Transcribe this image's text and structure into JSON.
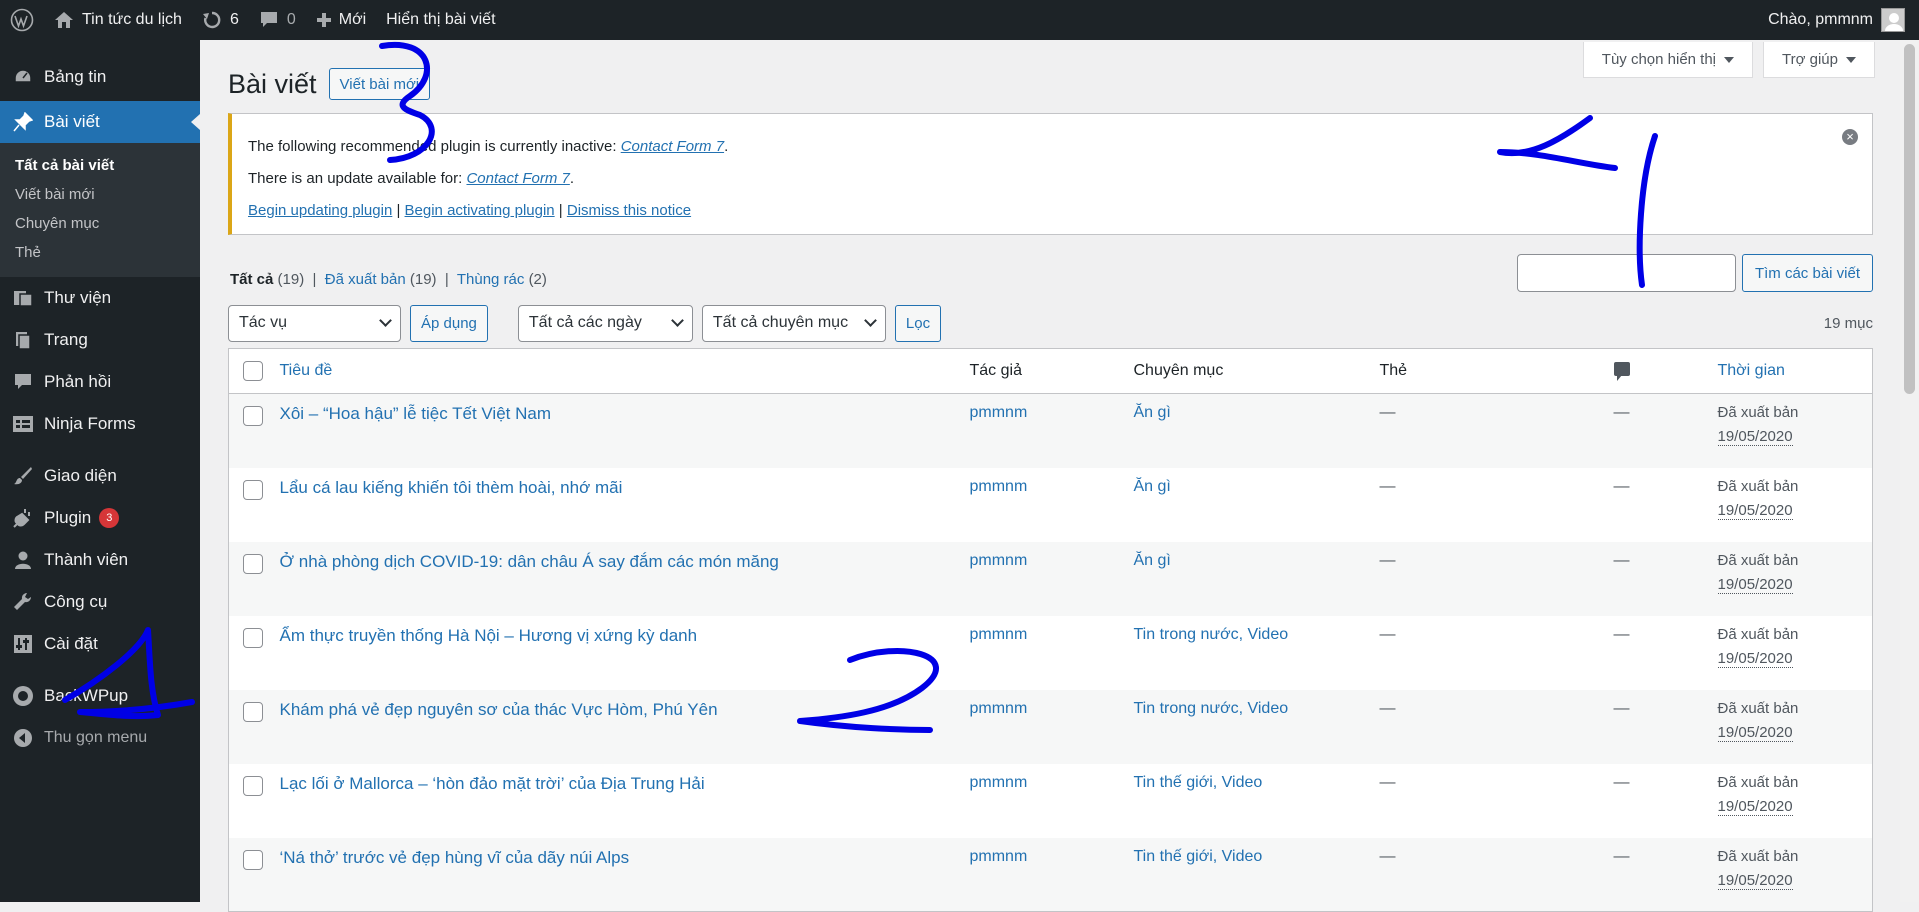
{
  "admin_bar": {
    "site_name": "Tin tức du lịch",
    "updates_count": "6",
    "comments_count": "0",
    "new_label": "Mới",
    "view_label": "Hiển thị bài viết",
    "greeting": "Chào, pmmnm"
  },
  "sidebar": {
    "items": [
      {
        "label": "Bảng tin",
        "icon": "dashboard-icon"
      },
      {
        "label": "Bài viết",
        "icon": "pin-icon"
      },
      {
        "label": "Thư viện",
        "icon": "media-icon"
      },
      {
        "label": "Trang",
        "icon": "page-icon"
      },
      {
        "label": "Phản hồi",
        "icon": "comments-icon"
      },
      {
        "label": "Ninja Forms",
        "icon": "forms-icon"
      },
      {
        "label": "Giao diện",
        "icon": "brush-icon"
      },
      {
        "label": "Plugin",
        "icon": "plugin-icon",
        "badge": "3"
      },
      {
        "label": "Thành viên",
        "icon": "user-icon"
      },
      {
        "label": "Công cụ",
        "icon": "wrench-icon"
      },
      {
        "label": "Cài đặt",
        "icon": "settings-icon"
      },
      {
        "label": "BackWPup",
        "icon": "backwpup-icon"
      },
      {
        "label": "Thu gọn menu",
        "icon": "collapse-icon"
      }
    ],
    "submenu": [
      "Tất cả bài viết",
      "Viết bài mới",
      "Chuyên mục",
      "Thẻ"
    ]
  },
  "screen_meta": {
    "options_label": "Tùy chọn hiển thị",
    "help_label": "Trợ giúp"
  },
  "page": {
    "title": "Bài viết",
    "add_new": "Viết bài mới"
  },
  "notice": {
    "line1_text": "The following recommended plugin is currently inactive: ",
    "line1_link": "Contact Form 7",
    "line2_text": "There is an update available for: ",
    "line2_link": "Contact Form 7",
    "link_update": "Begin updating plugin",
    "link_activate": "Begin activating plugin",
    "link_dismiss": "Dismiss this notice"
  },
  "views": {
    "all": "Tất cả",
    "all_count": "(19)",
    "published": "Đã xuất bản",
    "published_count": "(19)",
    "trash": "Thùng rác",
    "trash_count": "(2)"
  },
  "search": {
    "button": "Tìm các bài viết",
    "value": ""
  },
  "tablenav": {
    "bulk_action": "Tác vụ",
    "apply": "Áp dụng",
    "dates": "Tất cả các ngày",
    "categories": "Tất cả chuyên mục",
    "filter": "Lọc",
    "items_count": "19 mục"
  },
  "table": {
    "columns": {
      "title": "Tiêu đề",
      "author": "Tác giả",
      "categories": "Chuyên mục",
      "tags": "Thẻ",
      "date": "Thời gian"
    },
    "rows": [
      {
        "title": "Xôi – “Hoa hậu” lễ tiệc Tết Việt Nam",
        "author": "pmmnm",
        "categories": "Ăn gì",
        "tags": "—",
        "comments": "—",
        "status": "Đã xuất bản",
        "date": "19/05/2020"
      },
      {
        "title": "Lẩu cá lau kiếng khiến tôi thèm hoài, nhớ mãi",
        "author": "pmmnm",
        "categories": "Ăn gì",
        "tags": "—",
        "comments": "—",
        "status": "Đã xuất bản",
        "date": "19/05/2020"
      },
      {
        "title": "Ở nhà phòng dịch COVID-19: dân châu Á say đắm các món măng",
        "author": "pmmnm",
        "categories": "Ăn gì",
        "tags": "—",
        "comments": "—",
        "status": "Đã xuất bản",
        "date": "19/05/2020"
      },
      {
        "title": "Ẩm thực truyền thống Hà Nội – Hương vị xứng kỳ danh",
        "author": "pmmnm",
        "categories": "Tin trong nước, Video",
        "tags": "—",
        "comments": "—",
        "status": "Đã xuất bản",
        "date": "19/05/2020"
      },
      {
        "title": "Khám phá vẻ đẹp nguyên sơ của thác Vực Hòm, Phú Yên",
        "author": "pmmnm",
        "categories": "Tin trong nước, Video",
        "tags": "—",
        "comments": "—",
        "status": "Đã xuất bản",
        "date": "19/05/2020"
      },
      {
        "title": "Lạc lối ở Mallorca – ‘hòn đảo mặt trời’ của Địa Trung Hải",
        "author": "pmmnm",
        "categories": "Tin thế giới, Video",
        "tags": "—",
        "comments": "—",
        "status": "Đã xuất bản",
        "date": "19/05/2020"
      },
      {
        "title": "‘Ná thở’ trước vẻ đẹp hùng vĩ của dãy núi Alps",
        "author": "pmmnm",
        "categories": "Tin thế giới, Video",
        "tags": "—",
        "comments": "—",
        "status": "Đã xuất bản",
        "date": "19/05/2020"
      }
    ]
  },
  "annotations": [
    "1",
    "2",
    "3",
    "4"
  ]
}
